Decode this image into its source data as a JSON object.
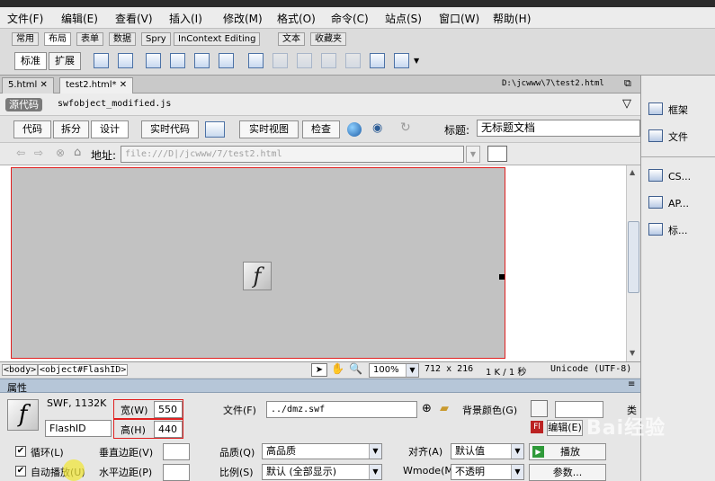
{
  "menu": [
    "文件(F)",
    "编辑(E)",
    "查看(V)",
    "插入(I)",
    "修改(M)",
    "格式(O)",
    "命令(C)",
    "站点(S)",
    "窗口(W)",
    "帮助(H)"
  ],
  "insert_tabs": [
    "常用",
    "布局",
    "表单",
    "数据",
    "Spry",
    "InContext Editing",
    "文本",
    "收藏夹"
  ],
  "insert_active": 1,
  "layout_modes": {
    "standard": "标准",
    "expanded": "扩展"
  },
  "doc_tabs": [
    {
      "label": "5.html"
    },
    {
      "label": "test2.html*"
    }
  ],
  "doc_path": "D:\\jcwww\\7\\test2.html",
  "source_label": "源代码",
  "related_file": "swfobject_modified.js",
  "view_buttons": {
    "code": "代码",
    "split": "拆分",
    "design": "设计",
    "live_code": "实时代码",
    "live_view": "实时视图",
    "inspect": "检查"
  },
  "title_label": "标题:",
  "title_value": "无标题文档",
  "address_label": "地址:",
  "address_value": "file:///D|/jcwww/7/test2.html",
  "status": {
    "tag_body": "<body>",
    "tag_object": "<object#FlashID>",
    "zoom": "100%",
    "dims": "712 x 216",
    "size": "1 K / 1 秒",
    "encoding": "Unicode (UTF-8)"
  },
  "props_title": "属性",
  "props": {
    "type": "SWF, 1132K",
    "id": "FlashID",
    "width_label": "宽(W)",
    "width": "550",
    "height_label": "高(H)",
    "height": "440",
    "file_label": "文件(F)",
    "file": "../dmz.swf",
    "bgcolor_label": "背景颜色(G)",
    "edit_label": "编辑(E)",
    "class_label": "类",
    "loop_label": "循环(L)",
    "autoplay_label": "自动播放(U)",
    "vspace_label": "垂直边距(V)",
    "hspace_label": "水平边距(P)",
    "quality_label": "品质(Q)",
    "quality": "高品质",
    "scale_label": "比例(S)",
    "scale": "默认 (全部显示)",
    "align_label": "对齐(A)",
    "align": "默认值",
    "wmode_label": "Wmode(M)",
    "wmode": "不透明",
    "play_label": "播放",
    "params_label": "参数..."
  },
  "right_panel": [
    "框架",
    "文件",
    "CS...",
    "AP...",
    "标..."
  ],
  "watermark": "Bai经验"
}
